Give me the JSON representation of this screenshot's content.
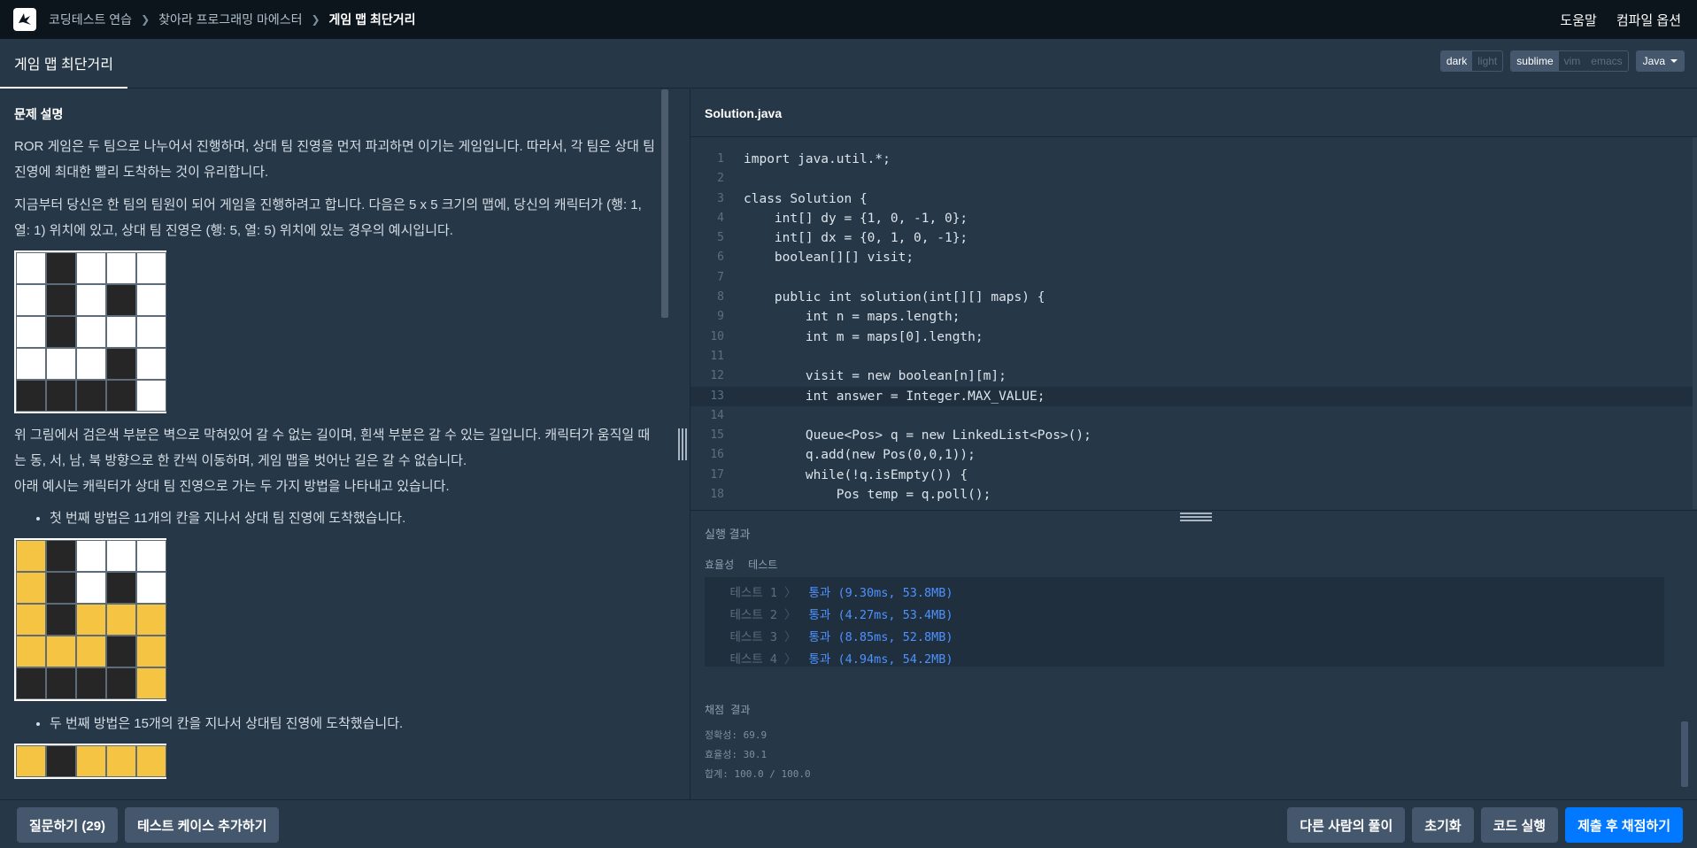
{
  "nav": {
    "breadcrumbs": [
      "코딩테스트 연습",
      "찾아라 프로그래밍 마에스터",
      "게임 맵 최단거리"
    ],
    "help": "도움말",
    "compile_options": "컴파일 옵션"
  },
  "tab": {
    "title": "게임 맵 최단거리"
  },
  "editor_options": {
    "theme": [
      "dark",
      "light"
    ],
    "theme_selected": "dark",
    "keymap": [
      "sublime",
      "vim",
      "emacs"
    ],
    "keymap_selected": "sublime",
    "language": "Java"
  },
  "problem": {
    "section_title": "문제 설명",
    "p1": "ROR 게임은 두 팀으로 나누어서 진행하며, 상대 팀 진영을 먼저 파괴하면 이기는 게임입니다. 따라서, 각 팀은 상대 팀 진영에 최대한 빨리 도착하는 것이 유리합니다.",
    "p2": "지금부터 당신은 한 팀의 팀원이 되어 게임을 진행하려고 합니다. 다음은 5 x 5 크기의 맵에, 당신의 캐릭터가 (행: 1, 열: 1) 위치에 있고, 상대 팀 진영은 (행: 5, 열: 5) 위치에 있는 경우의 예시입니다.",
    "p3": "위 그림에서 검은색 부분은 벽으로 막혀있어 갈 수 없는 길이며, 흰색 부분은 갈 수 있는 길입니다. 캐릭터가 움직일 때는 동, 서, 남, 북 방향으로 한 칸씩 이동하며, 게임 맵을 벗어난 길은 갈 수 없습니다.",
    "p4": "아래 예시는 캐릭터가 상대 팀 진영으로 가는 두 가지 방법을 나타내고 있습니다.",
    "bullet1": "첫 번째 방법은 11개의 칸을 지나서 상대 팀 진영에 도착했습니다.",
    "bullet2": "두 번째 방법은 15개의 칸을 지나서 상대팀 진영에 도착했습니다.",
    "map1": [
      [
        "w",
        "b",
        "w",
        "w",
        "w"
      ],
      [
        "w",
        "b",
        "w",
        "b",
        "w"
      ],
      [
        "w",
        "b",
        "w",
        "w",
        "w"
      ],
      [
        "w",
        "w",
        "w",
        "b",
        "w"
      ],
      [
        "b",
        "b",
        "b",
        "b",
        "w"
      ]
    ],
    "map2": [
      [
        "y",
        "b",
        "w",
        "w",
        "w"
      ],
      [
        "y",
        "b",
        "w",
        "b",
        "w"
      ],
      [
        "y",
        "b",
        "y",
        "y",
        "y"
      ],
      [
        "y",
        "y",
        "y",
        "b",
        "y"
      ],
      [
        "b",
        "b",
        "b",
        "b",
        "y"
      ]
    ],
    "map3_top": [
      "y",
      "b",
      "y",
      "y",
      "y"
    ]
  },
  "editor": {
    "filename": "Solution.java",
    "highlight_line": 13,
    "lines": [
      "import java.util.*;",
      "",
      "class Solution {",
      "    int[] dy = {1, 0, -1, 0};",
      "    int[] dx = {0, 1, 0, -1};",
      "    boolean[][] visit;",
      "",
      "    public int solution(int[][] maps) {",
      "        int n = maps.length;",
      "        int m = maps[0].length;",
      "",
      "        visit = new boolean[n][m];",
      "        int answer = Integer.MAX_VALUE;",
      "",
      "        Queue<Pos> q = new LinkedList<Pos>();",
      "        q.add(new Pos(0,0,1));",
      "        while(!q.isEmpty()) {",
      "            Pos temp = q.poll();"
    ]
  },
  "output": {
    "title": "실행 결과",
    "labels": [
      "효율성",
      "테스트"
    ],
    "tests": [
      {
        "name": "테스트 1",
        "sep": "〉",
        "result": "통과 (9.30ms, 53.8MB)"
      },
      {
        "name": "테스트 2",
        "sep": "〉",
        "result": "통과 (4.27ms, 53.4MB)"
      },
      {
        "name": "테스트 3",
        "sep": "〉",
        "result": "통과 (8.85ms, 52.8MB)"
      },
      {
        "name": "테스트 4",
        "sep": "〉",
        "result": "통과 (4.94ms, 54.2MB)"
      }
    ],
    "score_title": "채점 결과",
    "accuracy": "정확성: 69.9",
    "efficiency": "효율성: 30.1",
    "total": "합계: 100.0 / 100.0"
  },
  "bottom": {
    "ask": "질문하기 (29)",
    "add_testcase": "테스트 케이스 추가하기",
    "others": "다른 사람의 풀이",
    "reset": "초기화",
    "run": "코드 실행",
    "submit": "제출 후 채점하기"
  },
  "colors": {
    "accent": "#0078ff",
    "pass": "#4e91ff",
    "path": "#f5c443"
  }
}
